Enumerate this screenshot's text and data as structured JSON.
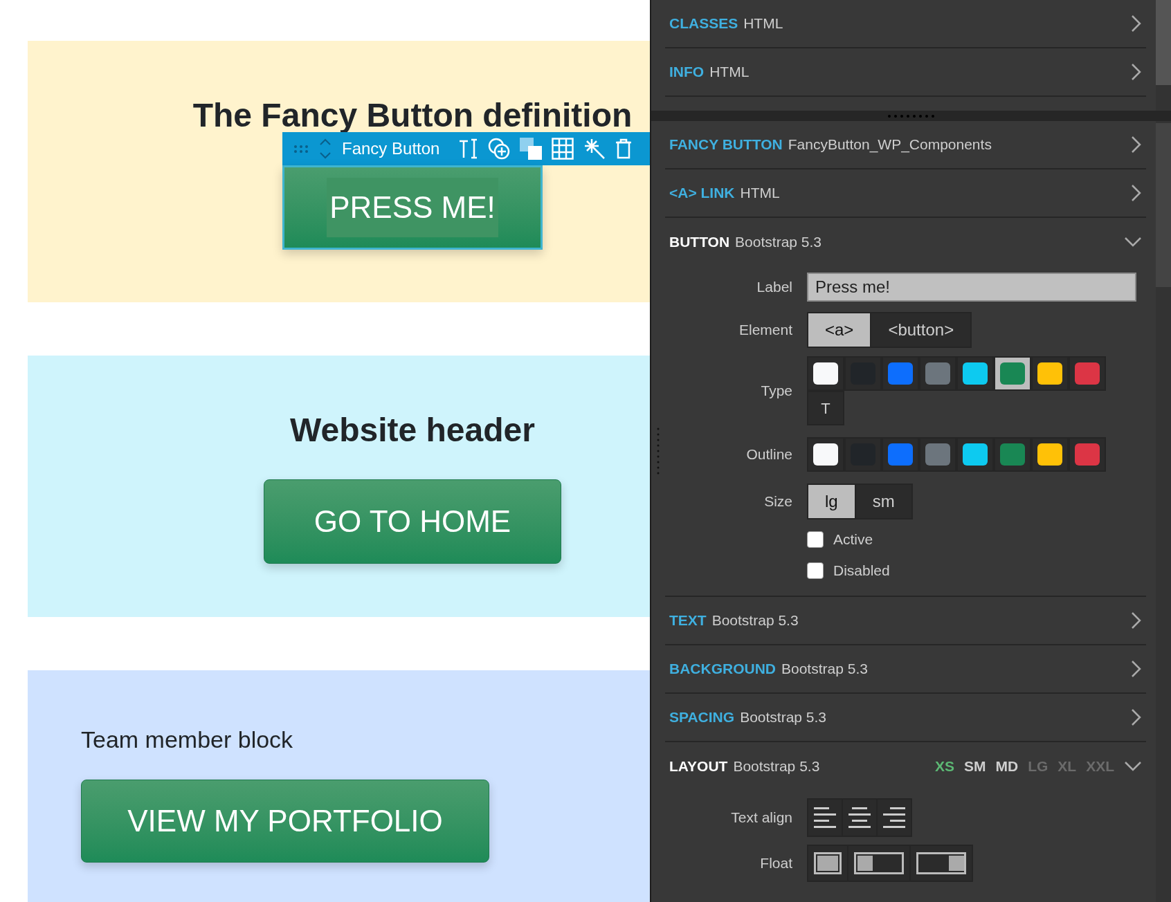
{
  "canvas": {
    "sections": [
      {
        "kind": "centered",
        "color": "#fff3cd",
        "heading": "The Fancy Button definition",
        "button": "PRESS ME!",
        "selected": true,
        "toolbar": {
          "label": "Fancy Button"
        }
      },
      {
        "kind": "centered",
        "color": "#cff4fc",
        "heading": "Website header",
        "button": "GO TO HOME",
        "selected": false
      },
      {
        "kind": "left",
        "color": "#cfe2ff",
        "heading": "Team member block",
        "button": "VIEW MY PORTFOLIO",
        "selected": false
      }
    ]
  },
  "panel": {
    "top_sections": [
      {
        "category": "CLASSES",
        "source": "HTML",
        "expanded": false
      },
      {
        "category": "INFO",
        "source": "HTML",
        "expanded": false
      }
    ],
    "sections": [
      {
        "category": "FANCY BUTTON",
        "source": "FancyButton_WP_Components",
        "expanded": false
      },
      {
        "category": "<A> LINK",
        "source": "HTML",
        "expanded": false
      },
      {
        "category": "BUTTON",
        "source": "Bootstrap 5.3",
        "expanded": true,
        "properties": [
          {
            "kind": "text_field",
            "label": "Label",
            "value": "Press me!"
          },
          {
            "kind": "segmented",
            "label": "Element",
            "options": [
              {
                "label": "<a>",
                "selected": true
              },
              {
                "label": "<button>",
                "selected": false
              }
            ]
          },
          {
            "kind": "swatches",
            "label": "Type",
            "items": [
              {
                "color": "#f8f9fa",
                "selected": false
              },
              {
                "color": "#212529",
                "selected": false
              },
              {
                "color": "#0d6efd",
                "selected": false
              },
              {
                "color": "#6c757d",
                "selected": false
              },
              {
                "color": "#0dcaf0",
                "selected": false
              },
              {
                "color": "#198754",
                "selected": true
              },
              {
                "color": "#ffc107",
                "selected": false
              },
              {
                "color": "#dc3545",
                "selected": false
              },
              {
                "label": "T",
                "selected": false
              }
            ]
          },
          {
            "kind": "swatches",
            "label": "Outline",
            "items": [
              {
                "color": "#f8f9fa",
                "selected": false
              },
              {
                "color": "#212529",
                "selected": false
              },
              {
                "color": "#0d6efd",
                "selected": false
              },
              {
                "color": "#6c757d",
                "selected": false
              },
              {
                "color": "#0dcaf0",
                "selected": false
              },
              {
                "color": "#198754",
                "selected": false
              },
              {
                "color": "#ffc107",
                "selected": false
              },
              {
                "color": "#dc3545",
                "selected": false
              }
            ]
          },
          {
            "kind": "segmented",
            "label": "Size",
            "options": [
              {
                "label": "lg",
                "selected": true
              },
              {
                "label": "sm",
                "selected": false
              }
            ]
          },
          {
            "kind": "checkbox",
            "label": "Active",
            "checked": false
          },
          {
            "kind": "checkbox",
            "label": "Disabled",
            "checked": false
          }
        ]
      },
      {
        "category": "TEXT",
        "source": "Bootstrap 5.3",
        "expanded": false
      },
      {
        "category": "BACKGROUND",
        "source": "Bootstrap 5.3",
        "expanded": false
      },
      {
        "category": "SPACING",
        "source": "Bootstrap 5.3",
        "expanded": false
      },
      {
        "category": "LAYOUT",
        "source": "Bootstrap 5.3",
        "expanded": true,
        "breakpoints": [
          {
            "label": "XS",
            "selected": true,
            "disabled": false
          },
          {
            "label": "SM",
            "selected": false,
            "disabled": false
          },
          {
            "label": "MD",
            "selected": false,
            "disabled": false
          },
          {
            "label": "LG",
            "selected": false,
            "disabled": true
          },
          {
            "label": "XL",
            "selected": false,
            "disabled": true
          },
          {
            "label": "XXL",
            "selected": false,
            "disabled": true
          }
        ],
        "properties": [
          {
            "kind": "align_buttons",
            "label": "Text align"
          },
          {
            "kind": "float_buttons",
            "label": "Float"
          }
        ]
      }
    ]
  }
}
